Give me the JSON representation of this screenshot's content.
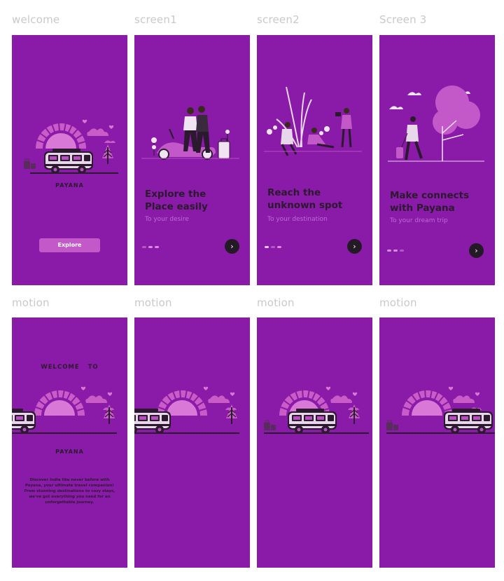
{
  "frames": {
    "welcome": {
      "label": "welcome",
      "brand": "PAYANA",
      "explore_label": "Explore"
    },
    "screen1": {
      "label": "screen1",
      "headline": "Explore the\nPlace easily",
      "subline": "To your desire",
      "next_icon": "chevron-right-icon"
    },
    "screen2": {
      "label": "screen2",
      "headline": "Reach the\nunknown spot",
      "subline": "To your destination",
      "next_icon": "chevron-right-icon"
    },
    "screen3": {
      "label": "Screen 3",
      "headline": "Make connects\nwith Payana",
      "subline": "To your dream trip",
      "next_icon": "chevron-right-icon"
    },
    "motion1": {
      "label": "motion",
      "welcome_title": "WELCOME   TO",
      "brand": "PAYANA",
      "description": "Discover India like never before with Payana, your ultimate travel companion! From stunning destinations to cozy stays, we've got everything you need for an unforgettable journey."
    },
    "motion2": {
      "label": "motion"
    },
    "motion3": {
      "label": "motion"
    },
    "motion4": {
      "label": "motion"
    }
  },
  "colors": {
    "background": "#8a1aa8",
    "accent": "#c359c9",
    "dark": "#2b1a2e",
    "label_gray": "#c9c9c9"
  }
}
